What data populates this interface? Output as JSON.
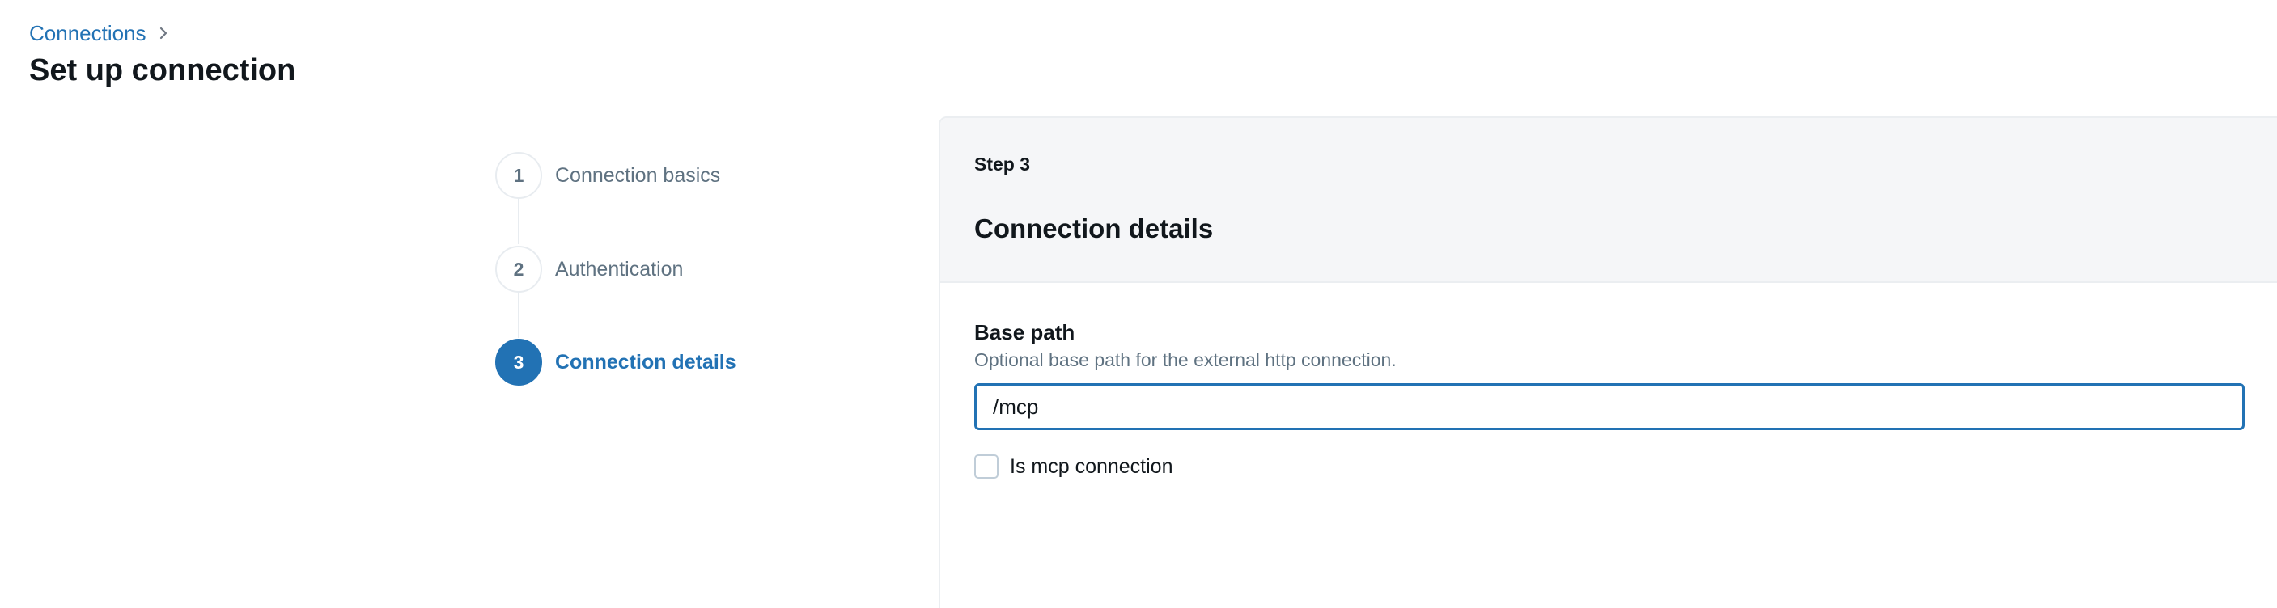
{
  "breadcrumb": {
    "items": [
      {
        "label": "Connections"
      }
    ],
    "separator_icon": "chevron-right-icon"
  },
  "page": {
    "title": "Set up connection"
  },
  "stepper": {
    "steps": [
      {
        "number": "1",
        "label": "Connection basics",
        "state": "completed"
      },
      {
        "number": "2",
        "label": "Authentication",
        "state": "completed"
      },
      {
        "number": "3",
        "label": "Connection details",
        "state": "active"
      }
    ]
  },
  "panel": {
    "step_label": "Step 3",
    "title": "Connection details",
    "base_path": {
      "label": "Base path",
      "help": "Optional base path for the external http connection.",
      "value": "/mcp",
      "placeholder": ""
    },
    "mcp_checkbox": {
      "label": "Is mcp connection",
      "checked": false
    }
  },
  "colors": {
    "accent": "#2272b4",
    "text": "#11171c",
    "muted": "#5f7281",
    "border": "#ebeef1",
    "header_bg": "#f5f6f8"
  }
}
